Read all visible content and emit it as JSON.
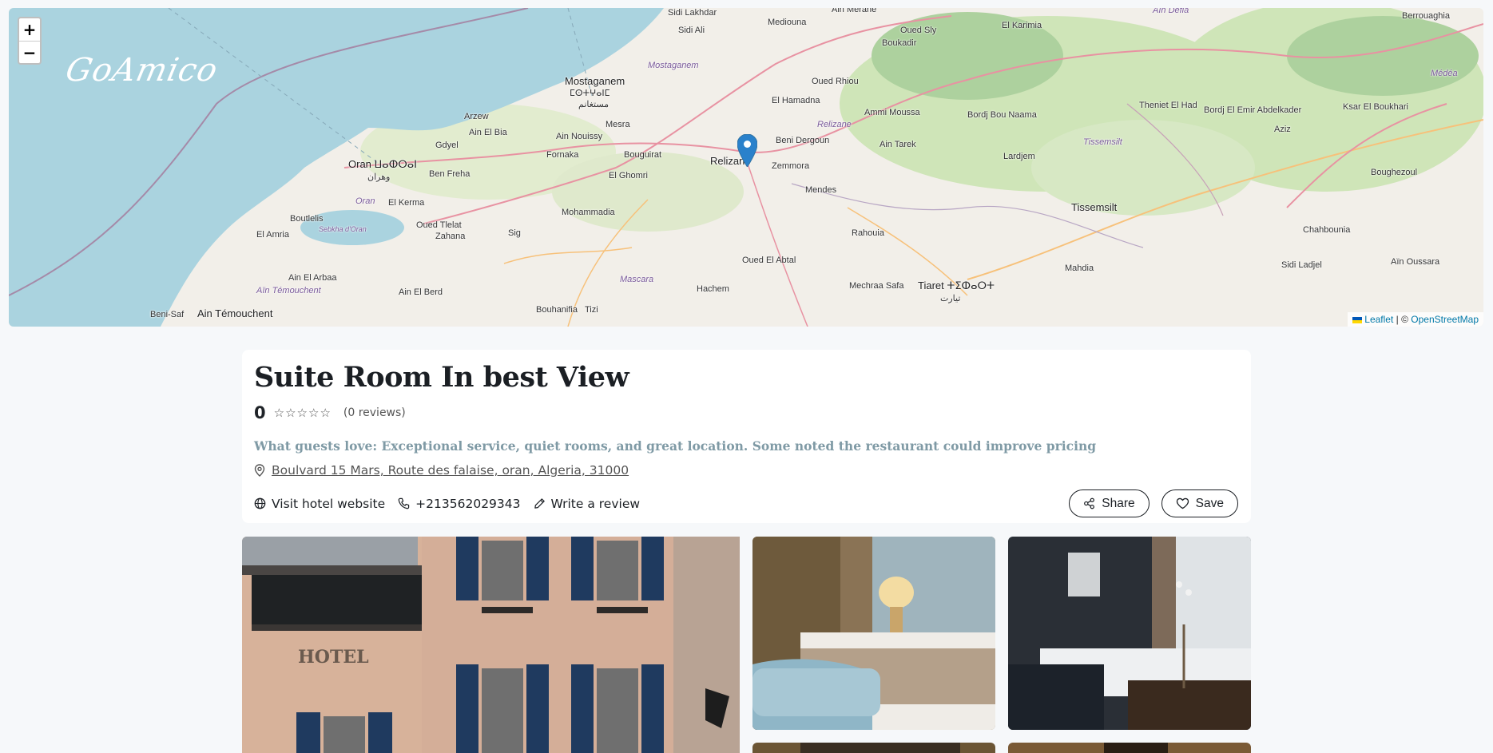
{
  "map": {
    "zoom_in": "+",
    "zoom_out": "−",
    "brand": "GoAmico",
    "attribution": {
      "leaflet": "Leaflet",
      "sep": "| ©",
      "osm": "OpenStreetMap"
    },
    "places": {
      "sidi_lakhdar": "Sidi Lakhdar",
      "sidi_ali": "Sidi Ali",
      "mediouna": "Mediouna",
      "ain_merane": "Ain Merane",
      "oued_sly": "Oued Sly",
      "boukadir": "Boukadir",
      "el_karimia": "El Karimia",
      "ain_defla": "Aïn Defla",
      "berrouaghia": "Berrouaghia",
      "medea": "Médéa",
      "mostaganem": "Mostaganem",
      "mostaganem_ar": "ⵎⵙⵜⵖⴰⵏⵎ",
      "mostaganem_ar2": "مستغانم",
      "mostaganem_reg": "Mostaganem",
      "oued_rhiou": "Oued Rhiou",
      "el_hamadna": "El Hamadna",
      "ammi_moussa": "Ammi Moussa",
      "relizane_reg": "Relizane",
      "arzew": "Arzew",
      "ain_el_bia": "Ain El Bia",
      "mesra": "Mesra",
      "gdyel": "Gdyel",
      "ain_nouissy": "Ain Nouissy",
      "fornaka": "Fornaka",
      "bouguirat": "Bouguirat",
      "relizane": "Relizane",
      "beni_dergoun": "Beni Dergoun",
      "zemmora": "Zemmora",
      "ain_tarek": "Ain Tarek",
      "bordj_bou_naama": "Bordj Bou Naama",
      "lardjem": "Lardjem",
      "tissemsilt_reg": "Tissemsilt",
      "theniet_el_had": "Theniet El Had",
      "bordj_el_emir": "Bordj El Emir Abdelkader",
      "aziz": "Aziz",
      "ksar_el_boukhari": "Ksar El Boukhari",
      "oran": "Oran ⵡⴰⵀⵔⴰⵏ",
      "oran_ar": "وهران",
      "ben_freha": "Ben Freha",
      "el_ghomri": "El Ghomri",
      "mendes": "Mendes",
      "oran_reg": "Oran",
      "el_kerma": "El Kerma",
      "boutlelis": "Boutlelis",
      "mohammadia": "Mohammadia",
      "tissemsilt": "Tissemsilt",
      "boughezoul": "Boughezoul",
      "el_amria": "El Amria",
      "sebkha": "Sebkha d'Oran",
      "oued_tlelat": "Oued Tlelat",
      "zahana": "Zahana",
      "sig": "Sig",
      "rahouia": "Rahouia",
      "chahbounia": "Chahbounia",
      "oued_el_abtal": "Oued El Abtal",
      "mahdia": "Mahdia",
      "sidi_ladjel": "Sidi Ladjel",
      "ain_oussara": "Aïn Oussara",
      "ain_el_arbaa": "Ain El Arbaa",
      "mascara": "Mascara",
      "mechraa_safa": "Mechraa Safa",
      "tiaret": "Tiaret ⵜⵉⵀⴰⵔⵜ",
      "tiaret_ar": "تيارت",
      "ain_temouchent_reg": "Aïn Témouchent",
      "ain_el_berd": "Ain El Berd",
      "hachem": "Hachem",
      "beni_saf": "Beni-Saf",
      "ain_temouchent": "Ain Témouchent",
      "bouhanifia": "Bouhanifia",
      "tizi": "Tizi"
    }
  },
  "hotel": {
    "title": "Suite Room In best View",
    "score": "0",
    "stars": [
      "☆",
      "☆",
      "☆",
      "☆",
      "☆"
    ],
    "reviews": "(0 reviews)",
    "guests_love": "What guests love: Exceptional service, quiet rooms, and great location. Some noted the restaurant could improve pricing",
    "address": "Boulvard 15 Mars, Route des falaise, oran, Algeria, 31000",
    "website": "Visit hotel website",
    "phone": "+213562029343",
    "write_review": "Write a review",
    "share": "Share",
    "save": "Save"
  },
  "gallery": {
    "main_sign": "HOTEL"
  },
  "colors": {
    "sea": "#aad3df",
    "land": "#f2efe9",
    "forest": "#add19e",
    "road": "#e892a2",
    "accent": "#2a81cb"
  }
}
